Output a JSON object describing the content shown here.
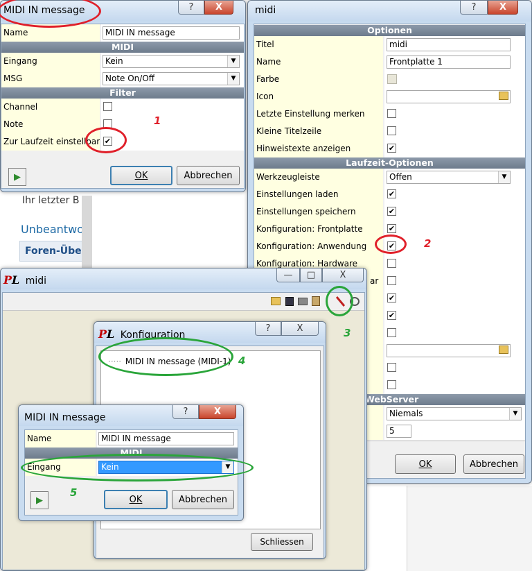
{
  "background": {
    "line1": "Ihr letzter B",
    "line2": "Unbeantwo",
    "line3": "Foren-Übe"
  },
  "dialog1": {
    "title": "MIDI IN message",
    "help": "?",
    "close": "X",
    "name_label": "Name",
    "name_value": "MIDI IN message",
    "section_midi": "MIDI",
    "eingang_label": "Eingang",
    "eingang_value": "Kein",
    "msg_label": "MSG",
    "msg_value": "Note On/Off",
    "section_filter": "Filter",
    "channel_label": "Channel",
    "note_label": "Note",
    "laufzeit_label": "Zur Laufzeit einstellbar",
    "check": "✔",
    "ok": "OK",
    "cancel": "Abbrechen"
  },
  "midi_window": {
    "title": "midi",
    "help": "?",
    "close": "X",
    "section_optionen": "Optionen",
    "rows": [
      {
        "label": "Titel",
        "value": "midi"
      },
      {
        "label": "Name",
        "value": "Frontplatte 1"
      },
      {
        "label": "Farbe"
      },
      {
        "label": "Icon",
        "value": ""
      },
      {
        "label": "Letzte Einstellung merken"
      },
      {
        "label": "Kleine Titelzeile"
      },
      {
        "label": "Hinweistexte anzeigen"
      }
    ],
    "section_laufzeit": "Laufzeit-Optionen",
    "rows2": [
      {
        "label": "Werkzeugleiste",
        "value": "Offen"
      },
      {
        "label": "Einstellungen laden"
      },
      {
        "label": "Einstellungen speichern"
      },
      {
        "label": "Konfiguration: Frontplatte"
      },
      {
        "label": "Konfiguration: Anwendung"
      },
      {
        "label": "Konfiguration: Hardware"
      }
    ],
    "partial_label": "ar",
    "section_webserver": "WebServer",
    "webserver_value": "Niemals",
    "spin_value": "5",
    "ok": "OK",
    "cancel": "Abbrechen"
  },
  "app_window": {
    "title": "midi",
    "min": "—",
    "max": "□",
    "close": "X"
  },
  "konfiguration": {
    "title": "Konfiguration",
    "help": "?",
    "close": "X",
    "tree_item": "MIDI IN message (MIDI-1)",
    "close_button": "Schliessen"
  },
  "dialog2": {
    "title": "MIDI IN message",
    "help": "?",
    "close": "X",
    "name_label": "Name",
    "name_value": "MIDI IN message",
    "section_midi": "MIDI",
    "eingang_label": "Eingang",
    "eingang_value": "Kein",
    "ok": "OK",
    "cancel": "Abbrechen"
  },
  "annotations": {
    "n1": "1",
    "n2": "2",
    "n3": "3",
    "n4": "4",
    "n5": "5",
    "accent_red": "#e0202a",
    "accent_green": "#2aa53a"
  }
}
